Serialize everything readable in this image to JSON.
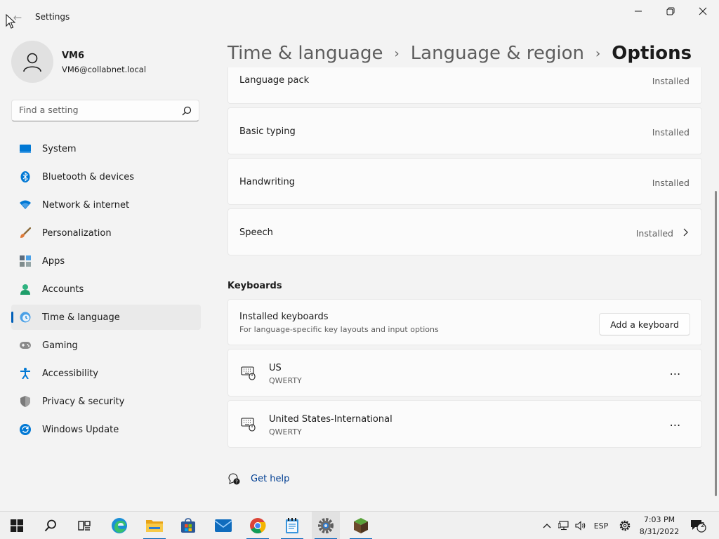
{
  "window": {
    "title": "Settings",
    "back_icon": "back-arrow-icon",
    "controls": [
      "minimize-icon",
      "maximize-icon",
      "close-icon"
    ]
  },
  "profile": {
    "name": "VM6",
    "email": "VM6@collabnet.local"
  },
  "search": {
    "placeholder": "Find a setting",
    "value": ""
  },
  "sidebar": {
    "items": [
      {
        "label": "System",
        "icon": "system-icon",
        "selected": false
      },
      {
        "label": "Bluetooth & devices",
        "icon": "bluetooth-icon",
        "selected": false
      },
      {
        "label": "Network & internet",
        "icon": "wifi-icon",
        "selected": false
      },
      {
        "label": "Personalization",
        "icon": "brush-icon",
        "selected": false
      },
      {
        "label": "Apps",
        "icon": "apps-icon",
        "selected": false
      },
      {
        "label": "Accounts",
        "icon": "accounts-icon",
        "selected": false
      },
      {
        "label": "Time & language",
        "icon": "time-language-icon",
        "selected": true
      },
      {
        "label": "Gaming",
        "icon": "gamepad-icon",
        "selected": false
      },
      {
        "label": "Accessibility",
        "icon": "accessibility-icon",
        "selected": false
      },
      {
        "label": "Privacy & security",
        "icon": "shield-icon",
        "selected": false
      },
      {
        "label": "Windows Update",
        "icon": "update-icon",
        "selected": false
      }
    ]
  },
  "breadcrumb": {
    "items": [
      "Time & language",
      "Language & region"
    ],
    "current": "Options"
  },
  "features": [
    {
      "title": "Language pack",
      "status": "Installed",
      "expandable": false
    },
    {
      "title": "Basic typing",
      "status": "Installed",
      "expandable": false
    },
    {
      "title": "Handwriting",
      "status": "Installed",
      "expandable": false
    },
    {
      "title": "Speech",
      "status": "Installed",
      "expandable": true
    }
  ],
  "keyboards": {
    "heading": "Keyboards",
    "installed": {
      "title": "Installed keyboards",
      "subtitle": "For language-specific key layouts and input options",
      "button": "Add a keyboard"
    },
    "items": [
      {
        "name": "US",
        "layout": "QWERTY"
      },
      {
        "name": "United States-International",
        "layout": "QWERTY"
      }
    ]
  },
  "help": {
    "label": "Get help"
  },
  "taskbar": {
    "apps": [
      "windows-start-icon",
      "search-icon",
      "task-view-icon",
      "edge-icon",
      "file-explorer-icon",
      "microsoft-store-icon",
      "mail-icon",
      "chrome-icon",
      "notepad-icon",
      "settings-icon",
      "minecraft-icon"
    ],
    "tray": {
      "language": "ESP",
      "time": "7:03 PM",
      "date": "8/31/2022",
      "notifications": "2"
    }
  },
  "colors": {
    "accent": "#005fb8",
    "background": "#f3f3f3",
    "card": "#fbfbfb",
    "link": "#003e92"
  }
}
